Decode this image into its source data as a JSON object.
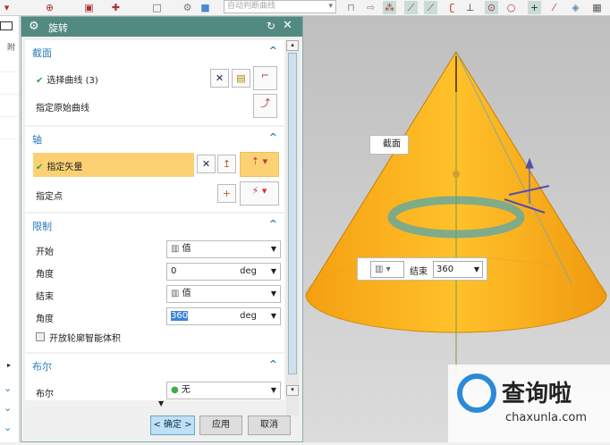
{
  "toolbar": {
    "filter_placeholder": "自动判断曲线"
  },
  "left_panel": {
    "header": "附"
  },
  "dialog": {
    "title": "旋转",
    "sections": {
      "section": {
        "title": "截面",
        "select_curve": "选择曲线 (3)",
        "specify_origin_curve": "指定原始曲线"
      },
      "axis": {
        "title": "轴",
        "specify_vector": "指定矢量",
        "specify_point": "指定点"
      },
      "limits": {
        "title": "限制",
        "start_label": "开始",
        "start_mode": "值",
        "start_angle_label": "角度",
        "start_angle": "0",
        "end_label": "结束",
        "end_mode": "值",
        "end_angle_label": "角度",
        "end_angle": "360",
        "unit": "deg",
        "open_profile": "开放轮廓智能体积",
        "open_profile_checked": false
      },
      "boolean": {
        "title": "布尔",
        "label": "布尔",
        "value": "无"
      }
    },
    "buttons": {
      "ok": "< 确定 >",
      "apply": "应用",
      "cancel": "取消"
    }
  },
  "viewport": {
    "section_callout": "截面",
    "end_label": "结束",
    "end_value": "360",
    "cone_color": "#f5a515"
  },
  "watermark": {
    "text": "查询啦",
    "url": "chaxunla.com"
  }
}
